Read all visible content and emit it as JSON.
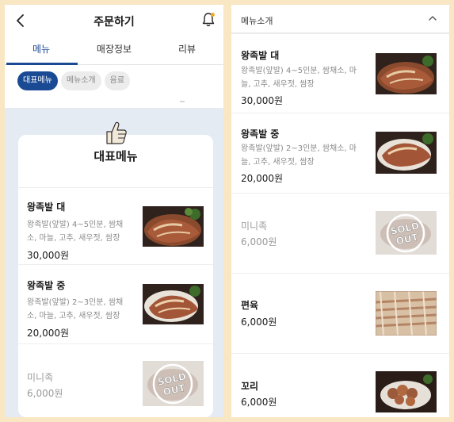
{
  "left": {
    "title": "주문하기",
    "tabs": [
      {
        "label": "메뉴",
        "active": true
      },
      {
        "label": "매장정보",
        "active": false
      },
      {
        "label": "리뷰",
        "active": false
      }
    ],
    "chips": [
      {
        "label": "대표메뉴",
        "active": true
      },
      {
        "label": "메뉴소개",
        "active": false
      },
      {
        "label": "음료",
        "active": false
      }
    ],
    "card": {
      "title": "대표메뉴",
      "items": [
        {
          "name": "왕족발 대",
          "desc1": "왕족발(앞발) 4~5인분, 쌈채",
          "desc2": "소, 마늘, 고추, 새우젓, 쌈장",
          "price": "30,000원",
          "sold_out": false
        },
        {
          "name": "왕족발 중",
          "desc1": "왕족발(앞발) 2~3인분, 쌈채",
          "desc2": "소, 마늘, 고추, 새우젓, 쌈장",
          "price": "20,000원",
          "sold_out": false
        },
        {
          "name": "미니족",
          "price": "6,000원",
          "sold_out": true,
          "badge": "SOLD OUT"
        }
      ]
    }
  },
  "right": {
    "section_title": "메뉴소개",
    "items": [
      {
        "name": "왕족발 대",
        "desc1": "왕족발(앞발) 4~5인분, 쌈채소, 마",
        "desc2": "늘, 고추, 새우젓, 쌈장",
        "price": "30,000원",
        "sold_out": false
      },
      {
        "name": "왕족발 중",
        "desc1": "왕족발(앞발) 2~3인분, 쌈채소, 마",
        "desc2": "늘, 고추, 새우젓, 쌈장",
        "price": "20,000원",
        "sold_out": false
      },
      {
        "name": "미니족",
        "price": "6,000원",
        "sold_out": true,
        "badge": "SOLD OUT"
      },
      {
        "name": "편육",
        "price": "6,000원",
        "sold_out": false
      },
      {
        "name": "꼬리",
        "price": "6,000원",
        "sold_out": false
      }
    ]
  },
  "colors": {
    "background": "#f9e6c3",
    "accent": "#1a4a94",
    "grey_area": "#e4ebf3"
  },
  "icons": [
    "back-arrow-icon",
    "bell-icon",
    "thumbs-up-icon",
    "chevron-up-icon"
  ]
}
